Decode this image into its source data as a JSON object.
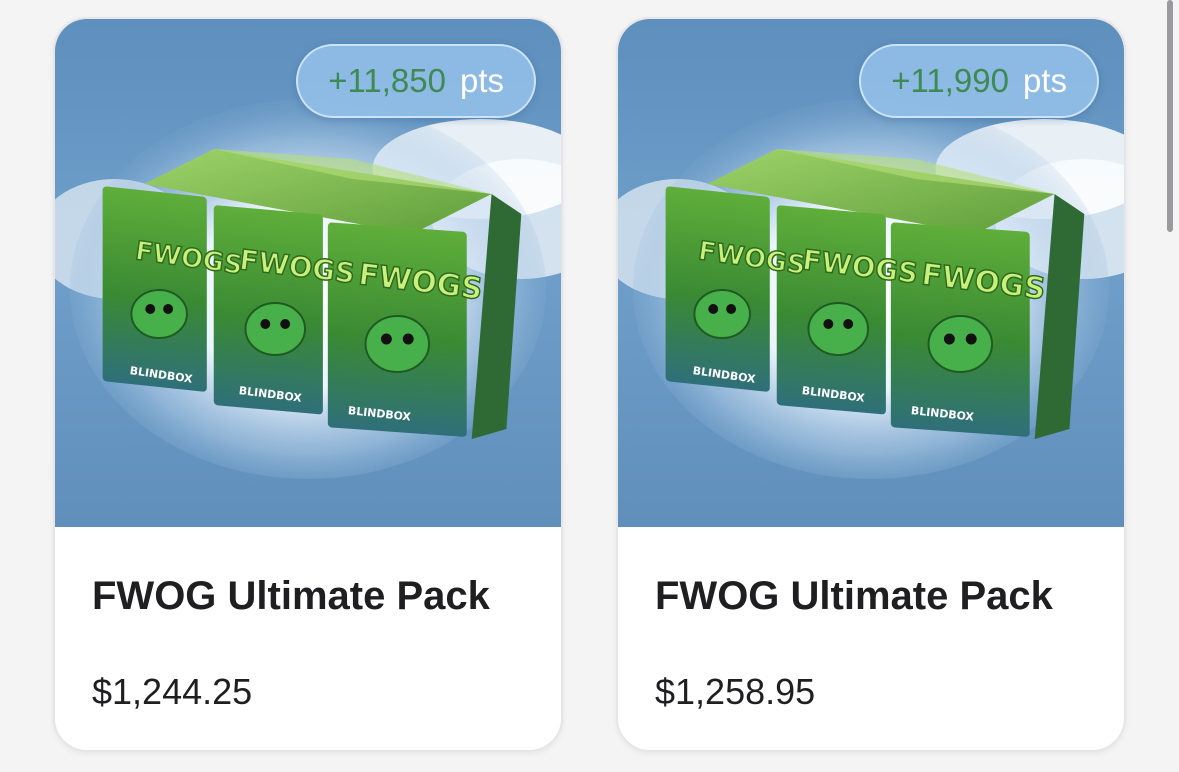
{
  "products": [
    {
      "points_value": "+11,850",
      "points_unit": "pts",
      "title": "FWOG Ultimate Pack",
      "price": "$1,244.25",
      "image_alt": "FWOGS BLINDBOX"
    },
    {
      "points_value": "+11,990",
      "points_unit": "pts",
      "title": "FWOG Ultimate Pack",
      "price": "$1,258.95",
      "image_alt": "FWOGS BLINDBOX"
    }
  ],
  "colors": {
    "points_green": "#3f8a54",
    "badge_bg": "#96c3eb",
    "sky_blue": "#6f9fca",
    "box_green": "#3f9a3a",
    "text_dark": "#1f1f22"
  }
}
